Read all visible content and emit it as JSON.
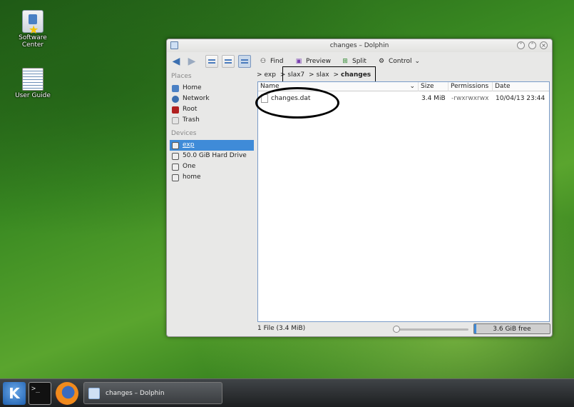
{
  "desktop": {
    "icons": [
      {
        "label": "Software Center",
        "icon": "software-center-icon"
      },
      {
        "label": "User Guide",
        "icon": "user-guide-icon"
      }
    ]
  },
  "window": {
    "title": "changes – Dolphin",
    "buttons": {
      "minimize": "˅",
      "maximize": "˄",
      "close": "×"
    }
  },
  "toolbar": {
    "find": "Find",
    "preview": "Preview",
    "split": "Split",
    "control": "Control"
  },
  "sidebar": {
    "places_heading": "Places",
    "places": [
      {
        "label": "Home",
        "color": "#4a80c4"
      },
      {
        "label": "Network",
        "color": "#3a6fb0"
      },
      {
        "label": "Root",
        "color": "#b02020"
      },
      {
        "label": "Trash",
        "color": "#d8d8d8"
      }
    ],
    "devices_heading": "Devices",
    "devices": [
      {
        "label": "exp",
        "selected": true
      },
      {
        "label": "50.0 GiB Hard Drive"
      },
      {
        "label": "One"
      },
      {
        "label": "home"
      }
    ]
  },
  "breadcrumb": {
    "segments": [
      "exp",
      "slax7",
      "slax",
      "changes"
    ],
    "separator": ">"
  },
  "columns": {
    "name": "Name",
    "size": "Size",
    "permissions": "Permissions",
    "date": "Date"
  },
  "files": [
    {
      "name": "changes.dat",
      "size": "3.4 MiB",
      "permissions": "-rwxrwxrwx",
      "date": "10/04/13 23:44"
    }
  ],
  "status": {
    "summary": "1 File (3.4 MiB)",
    "free_space": "3.6 GiB free",
    "zoom_level": 0
  },
  "taskbar": {
    "task_label": "changes – Dolphin",
    "k_menu_label": "K",
    "terminal_label": ">_"
  },
  "colors": {
    "accent": "#3f8bd8",
    "annotation": "#000000"
  }
}
